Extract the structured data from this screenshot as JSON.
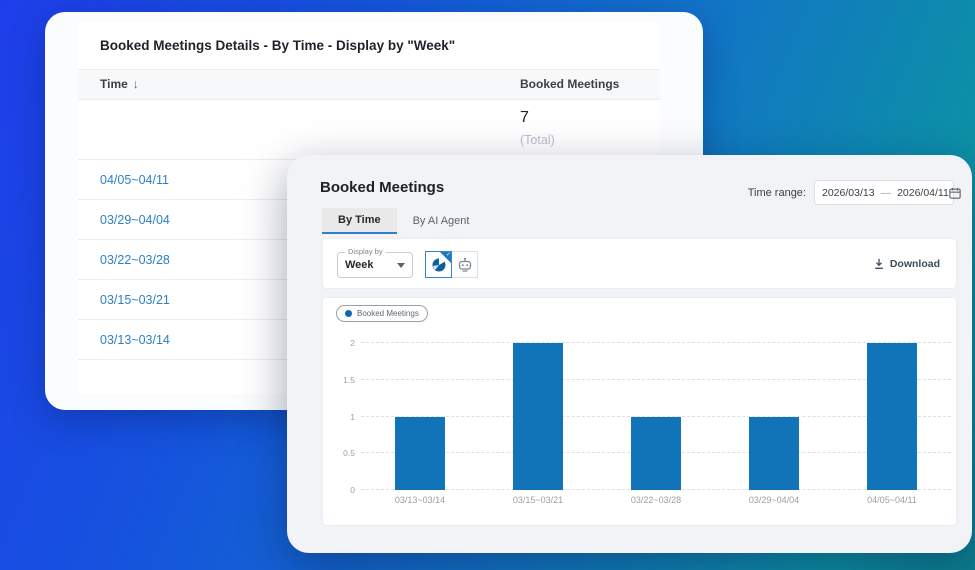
{
  "background": {
    "gradient_from": "#1e3eea",
    "gradient_to": "#0d7e8e"
  },
  "details_card": {
    "title": "Booked Meetings Details - By Time - Display by \"Week\"",
    "table": {
      "time_column": "Time",
      "sort_icon": "arrow-down",
      "meetings_column": "Booked Meetings",
      "total_value": "7",
      "total_label": "(Total)",
      "rows": [
        {
          "time": "04/05~04/11"
        },
        {
          "time": "03/29~04/04"
        },
        {
          "time": "03/22~03/28"
        },
        {
          "time": "03/15~03/21"
        },
        {
          "time": "03/13~03/14"
        }
      ],
      "link_color": "#2e80c4"
    }
  },
  "main_card": {
    "title": "Booked Meetings",
    "time_range": {
      "label": "Time range:",
      "start": "2026/03/13",
      "separator": "—",
      "end": "2026/04/11"
    },
    "tabs": [
      {
        "label": "By Time",
        "active": true
      },
      {
        "label": "By AI Agent",
        "active": false
      }
    ],
    "toolbar": {
      "display_by_label": "Display by",
      "display_by_value": "Week",
      "view_icons": [
        "pie-time-view",
        "ai-agent-view"
      ],
      "selected_view": "pie-time-view",
      "download_label": "Download"
    },
    "legend": {
      "label": "Booked Meetings",
      "dot_color": "#1167ad"
    },
    "accent_color": "#2e7fc5"
  },
  "chart_data": {
    "type": "bar",
    "title": "Booked Meetings",
    "categories": [
      "03/13~03/14",
      "03/15~03/21",
      "03/22~03/28",
      "03/29~04/04",
      "04/05~04/11"
    ],
    "values": [
      1,
      2,
      1,
      1,
      2
    ],
    "yticks": [
      0,
      0.5,
      1,
      1.5,
      2
    ],
    "ylim": [
      0,
      2
    ],
    "xlabel": "",
    "ylabel": "",
    "bar_color": "#1174b8",
    "grid": true,
    "grid_style": "dashed",
    "legend_position": "top-left"
  }
}
